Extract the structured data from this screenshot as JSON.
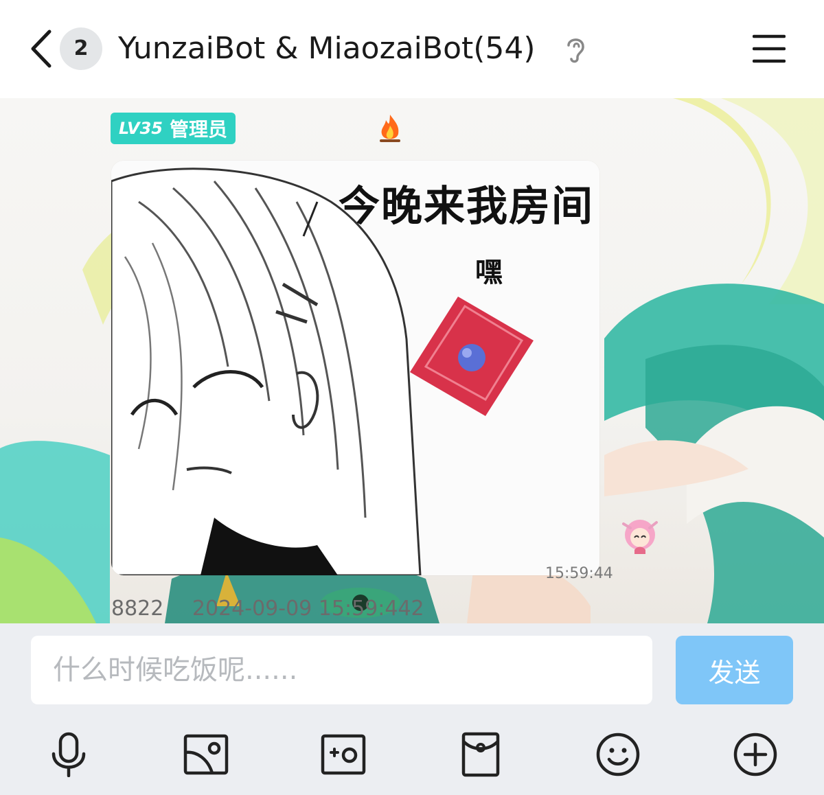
{
  "header": {
    "unread_count": "2",
    "title": "YunzaiBot & MiaozaiBot(54)",
    "icons": [
      "back-arrow-icon",
      "ear-icon",
      "menu-icon"
    ]
  },
  "message": {
    "level_prefix": "LV35",
    "role": "管理员",
    "image_caption": "今晚来我房间",
    "image_sfx": "嘿",
    "time": "15:59:44",
    "footer_sender": "8822",
    "footer_timestamp": "2024-09-09 15:59:442"
  },
  "input": {
    "placeholder": "什么时候吃饭呢......",
    "send_label": "发送"
  },
  "toolbar": [
    "microphone-icon",
    "image-icon",
    "camera-icon",
    "red-packet-icon",
    "emoji-icon",
    "plus-icon"
  ],
  "colors": {
    "level_badge": "#2fd1c2",
    "send_button": "#7fc6f8",
    "input_bar_bg": "#eceef2"
  }
}
